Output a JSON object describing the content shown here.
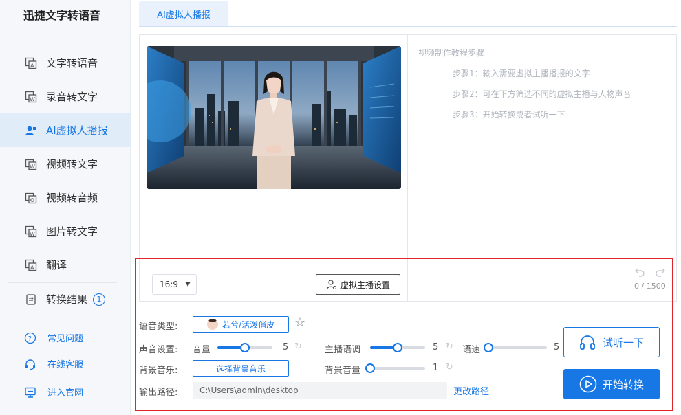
{
  "app": {
    "title": "迅捷文字转语音"
  },
  "sidebar": {
    "items": [
      {
        "label": "文字转语音",
        "icon": "text-to-speech-icon"
      },
      {
        "label": "录音转文字",
        "icon": "recording-to-text-icon"
      },
      {
        "label": "AI虚拟人播报",
        "icon": "virtual-anchor-icon",
        "active": true
      },
      {
        "label": "视频转文字",
        "icon": "video-to-text-icon"
      },
      {
        "label": "视频转音频",
        "icon": "video-to-audio-icon"
      },
      {
        "label": "图片转文字",
        "icon": "image-to-text-icon"
      },
      {
        "label": "翻译",
        "icon": "translate-icon"
      }
    ],
    "result": {
      "label": "转换结果",
      "badge": "1"
    },
    "links": [
      {
        "label": "常见问题",
        "icon": "help-icon"
      },
      {
        "label": "在线客服",
        "icon": "headset-icon"
      },
      {
        "label": "进入官网",
        "icon": "monitor-icon"
      }
    ]
  },
  "main": {
    "tab": "AI虚拟人播报",
    "tutorial": {
      "title": "视频制作教程步骤",
      "steps": [
        "步骤1：输入需要虚拟主播播报的文字",
        "步骤2：可在下方筛选不同的虚拟主播与人物声音",
        "步骤3：开始转换或者试听一下"
      ]
    },
    "ratio": "16:9",
    "anchor_settings": "虚拟主播设置",
    "counter": "0 / 1500"
  },
  "settings": {
    "voice_type_label": "语音类型:",
    "voice_name": "若兮/活泼俏皮",
    "sound_label": "声音设置:",
    "volume_label": "音量",
    "volume_value": "5",
    "pitch_label": "主播语调",
    "pitch_value": "5",
    "speed_label": "语速",
    "speed_value": "5",
    "bgm_label": "背景音乐:",
    "bgm_button": "选择背景音乐",
    "bgm_volume_label": "背景音量",
    "bgm_volume_value": "1",
    "output_label": "输出路径:",
    "output_path": "C:\\Users\\admin\\desktop",
    "change_path": "更改路径",
    "listen_button": "试听一下",
    "start_button": "开始转换",
    "levels": {
      "volume": 0.5,
      "pitch": 0.5,
      "speed": 0.0,
      "bgm_volume": 0.0
    }
  },
  "colors": {
    "accent": "#1677e5",
    "highlight_border": "#e0262a"
  }
}
